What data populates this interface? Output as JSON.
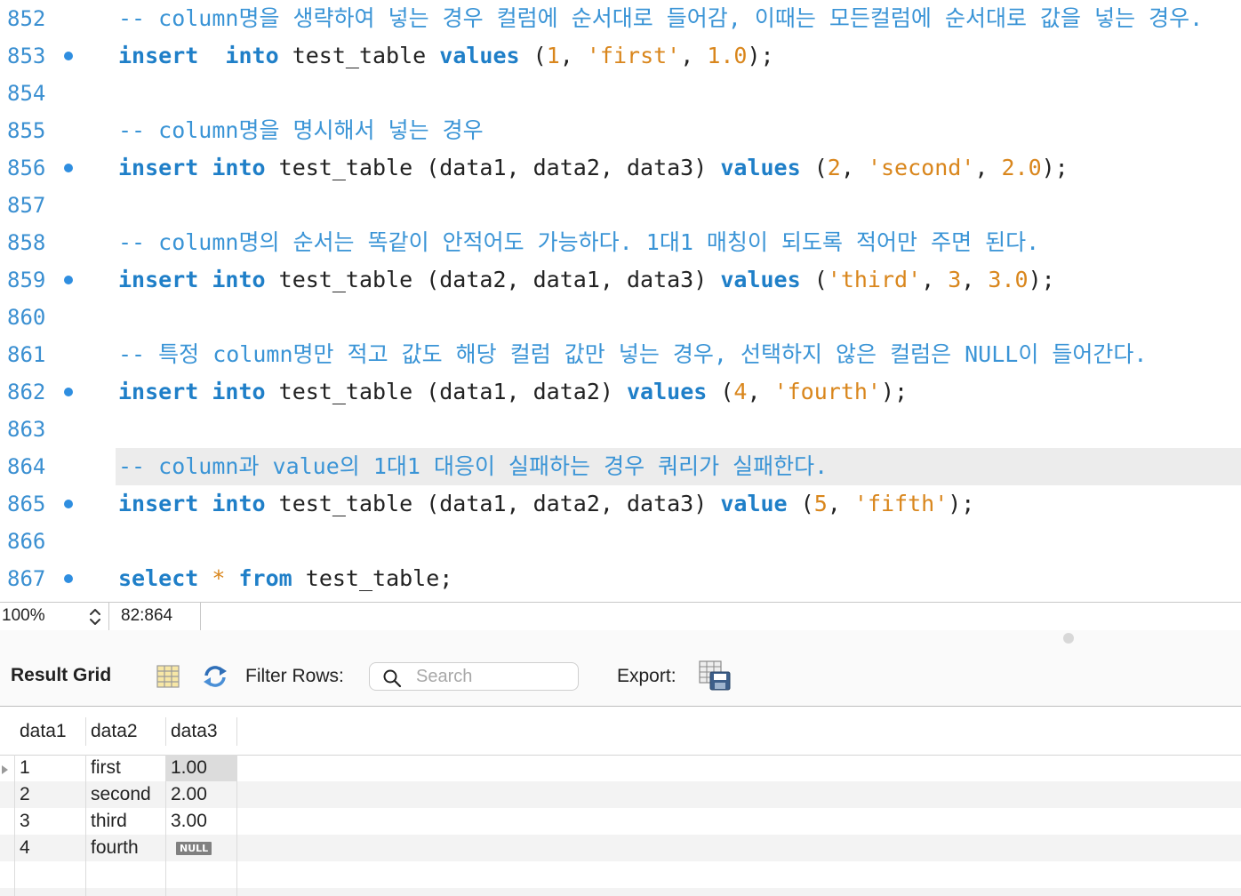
{
  "editor": {
    "lines": [
      {
        "num": "852",
        "bp": false,
        "tokens": [
          [
            "cm",
            "-- column명을 생략하여 넣는 경우 컬럼에 순서대로 들어감, 이때는 모든컬럼에 순서대로 값을 넣는 경우."
          ]
        ]
      },
      {
        "num": "853",
        "bp": true,
        "tokens": [
          [
            "kw",
            "insert"
          ],
          [
            "",
            "  "
          ],
          [
            "kw",
            "into"
          ],
          [
            "",
            " test_table "
          ],
          [
            "kw",
            "values"
          ],
          [
            "",
            " ("
          ],
          [
            "num",
            "1"
          ],
          [
            "",
            ", "
          ],
          [
            "str",
            "'first'"
          ],
          [
            "",
            ", "
          ],
          [
            "num",
            "1.0"
          ],
          [
            "",
            ");"
          ]
        ]
      },
      {
        "num": "854",
        "bp": false,
        "tokens": []
      },
      {
        "num": "855",
        "bp": false,
        "tokens": [
          [
            "cm",
            "-- column명을 명시해서 넣는 경우"
          ]
        ]
      },
      {
        "num": "856",
        "bp": true,
        "tokens": [
          [
            "kw",
            "insert"
          ],
          [
            "",
            " "
          ],
          [
            "kw",
            "into"
          ],
          [
            "",
            " test_table (data1, data2, data3) "
          ],
          [
            "kw",
            "values"
          ],
          [
            "",
            " ("
          ],
          [
            "num",
            "2"
          ],
          [
            "",
            ", "
          ],
          [
            "str",
            "'second'"
          ],
          [
            "",
            ", "
          ],
          [
            "num",
            "2.0"
          ],
          [
            "",
            ");"
          ]
        ]
      },
      {
        "num": "857",
        "bp": false,
        "tokens": []
      },
      {
        "num": "858",
        "bp": false,
        "tokens": [
          [
            "cm",
            "-- column명의 순서는 똑같이 안적어도 가능하다. 1대1 매칭이 되도록 적어만 주면 된다."
          ]
        ]
      },
      {
        "num": "859",
        "bp": true,
        "tokens": [
          [
            "kw",
            "insert"
          ],
          [
            "",
            " "
          ],
          [
            "kw",
            "into"
          ],
          [
            "",
            " test_table (data2, data1, data3) "
          ],
          [
            "kw",
            "values"
          ],
          [
            "",
            " ("
          ],
          [
            "str",
            "'third'"
          ],
          [
            "",
            ", "
          ],
          [
            "num",
            "3"
          ],
          [
            "",
            ", "
          ],
          [
            "num",
            "3.0"
          ],
          [
            "",
            ");"
          ]
        ]
      },
      {
        "num": "860",
        "bp": false,
        "tokens": []
      },
      {
        "num": "861",
        "bp": false,
        "tokens": [
          [
            "cm",
            "-- 특정 column명만 적고 값도 해당 컬럼 값만 넣는 경우, 선택하지 않은 컬럼은 NULL이 들어간다."
          ]
        ]
      },
      {
        "num": "862",
        "bp": true,
        "tokens": [
          [
            "kw",
            "insert"
          ],
          [
            "",
            " "
          ],
          [
            "kw",
            "into"
          ],
          [
            "",
            " test_table (data1, data2) "
          ],
          [
            "kw",
            "values"
          ],
          [
            "",
            " ("
          ],
          [
            "num",
            "4"
          ],
          [
            "",
            ", "
          ],
          [
            "str",
            "'fourth'"
          ],
          [
            "",
            ");"
          ]
        ]
      },
      {
        "num": "863",
        "bp": false,
        "tokens": []
      },
      {
        "num": "864",
        "bp": false,
        "highlight": true,
        "tokens": [
          [
            "cm",
            "-- column과 value의 1대1 대응이 실패하는 경우 쿼리가 실패한다."
          ]
        ]
      },
      {
        "num": "865",
        "bp": true,
        "tokens": [
          [
            "kw",
            "insert"
          ],
          [
            "",
            " "
          ],
          [
            "kw",
            "into"
          ],
          [
            "",
            " test_table (data1, data2, data3) "
          ],
          [
            "kw",
            "value"
          ],
          [
            "",
            " ("
          ],
          [
            "num",
            "5"
          ],
          [
            "",
            ", "
          ],
          [
            "str",
            "'fifth'"
          ],
          [
            "",
            ");"
          ]
        ]
      },
      {
        "num": "866",
        "bp": false,
        "tokens": []
      },
      {
        "num": "867",
        "bp": true,
        "tokens": [
          [
            "kw",
            "select"
          ],
          [
            "",
            " "
          ],
          [
            "ar",
            "*"
          ],
          [
            "",
            " "
          ],
          [
            "kw",
            "from"
          ],
          [
            "",
            " test_table;"
          ]
        ]
      }
    ]
  },
  "statusbar": {
    "zoom": "100%",
    "cursor_position": "82:864"
  },
  "result_toolbar": {
    "title": "Result Grid",
    "filter_label": "Filter Rows:",
    "search_placeholder": "Search",
    "export_label": "Export:"
  },
  "result_grid": {
    "columns": [
      "data1",
      "data2",
      "data3"
    ],
    "rows": [
      {
        "data1": "1",
        "data2": "first",
        "data3": "1.00"
      },
      {
        "data1": "2",
        "data2": "second",
        "data3": "2.00"
      },
      {
        "data1": "3",
        "data2": "third",
        "data3": "3.00"
      },
      {
        "data1": "4",
        "data2": "fourth",
        "data3": "NULL"
      }
    ]
  },
  "icons": {
    "zoom_stepper": "chevron-up-down-icon",
    "grid_toggle": "grid-icon",
    "refresh": "refresh-icon",
    "search": "search-icon",
    "export": "export-icon"
  },
  "colors": {
    "keyword": "#1f7fc8",
    "comment": "#3a94d6",
    "literal": "#d9861c",
    "line_number": "#3a8fd1",
    "breakpoint": "#2f8ee0"
  }
}
